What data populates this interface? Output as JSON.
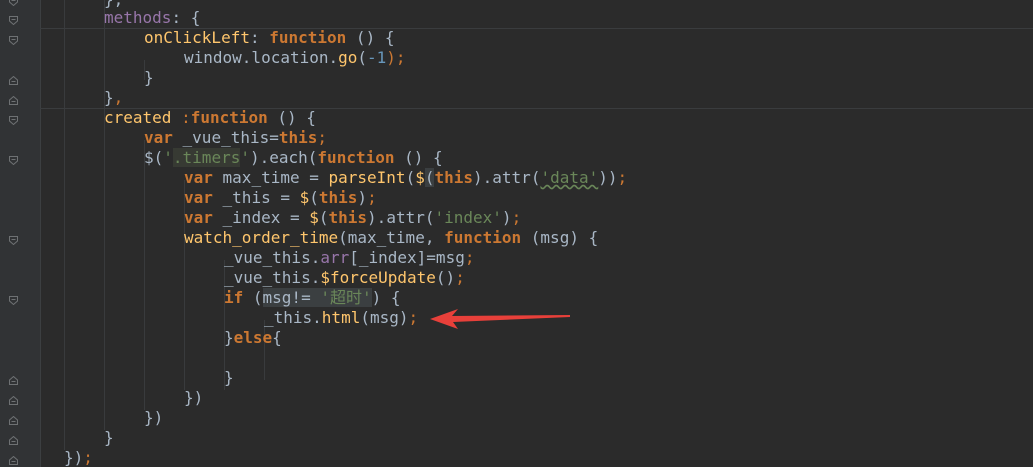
{
  "editor": {
    "gutter_icon": "fold-marker-icon",
    "lines": {
      "l0": {
        "t1": "},"
      },
      "l1": {
        "t1": "methods",
        "t2": ": {"
      },
      "l2": {
        "t1": "onClickLeft",
        "t2": ": ",
        "t3": "function",
        "t4": " () {"
      },
      "l3": {
        "t1": "window.location.",
        "t2": "go",
        "t3": "(",
        "t4": "-1",
        "t5": ");"
      },
      "l4": {
        "t1": "}"
      },
      "l5": {
        "t1": "}",
        "t2": ","
      },
      "l6": {
        "t1": "created",
        "t2": " :",
        "t3": "function",
        "t4": " () {"
      },
      "l7": {
        "t1": "var",
        "t2": " _vue_this=",
        "t3": "this",
        "t4": ";"
      },
      "l8": {
        "t1": "$(",
        "t2": "'",
        "t3": ".timers",
        "t4": "'",
        "t5": ").each(",
        "t6": "function",
        "t7": " () {"
      },
      "l9": {
        "t1": "var",
        "t2": " max_time = ",
        "t3": "parseInt",
        "t4": "(",
        "t5": "$",
        "t6": "(",
        "t7": "this",
        "t8": ").attr(",
        "t9": "'data'",
        "t10": "))",
        "t11": ";"
      },
      "l10": {
        "t1": "var",
        "t2": " _this = ",
        "t3": "$",
        "t4": "(",
        "t5": "this",
        "t6": ")",
        "t7": ";"
      },
      "l11": {
        "t1": "var",
        "t2": " _index = ",
        "t3": "$",
        "t4": "(",
        "t5": "this",
        "t6": ").attr(",
        "t7": "'index'",
        "t8": ")",
        "t9": ";"
      },
      "l12": {
        "t1": "watch_order_time",
        "t2": "(max_time, ",
        "t3": "function",
        "t4": " (msg) {"
      },
      "l13": {
        "t1": "_vue_this.",
        "t2": "arr",
        "t3": "[_index]=msg",
        "t4": ";"
      },
      "l14": {
        "t1": "_vue_this.",
        "t2": "$forceUpdate",
        "t3": "()",
        "t4": ";"
      },
      "l15": {
        "t1": "if",
        "t2": " (",
        "t3": "msg!=",
        "t4": " ",
        "t5": "'超时'",
        "t6": ") {"
      },
      "l16": {
        "t1": "_this.",
        "t2": "html",
        "t3": "(msg)",
        "t4": ";"
      },
      "l17": {
        "t1": "}",
        "t2": "else",
        "t3": "{"
      },
      "l18": {
        "t1": ""
      },
      "l19": {
        "t1": "}"
      },
      "l20": {
        "t1": "})"
      },
      "l21": {
        "t1": "})"
      },
      "l22": {
        "t1": "}"
      },
      "l23": {
        "t1": "})",
        "t2": ";"
      }
    }
  },
  "annotation": {
    "arrow_icon": "red-arrow-icon",
    "color": "#e8403a"
  },
  "colors": {
    "background": "#2b2b2b",
    "gutter": "#313335",
    "keyword": "#cc7832",
    "property": "#9876aa",
    "function": "#ffc66d",
    "string": "#6a8759",
    "number": "#6897bb",
    "text": "#a9b7c6"
  }
}
